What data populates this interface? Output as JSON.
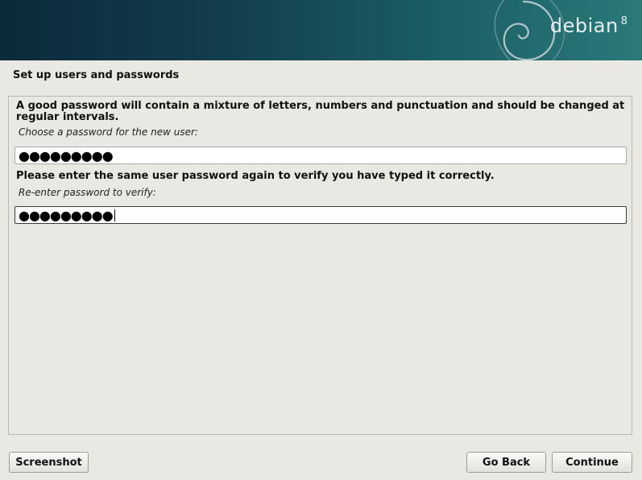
{
  "header": {
    "brand_name": "debian",
    "brand_version": "8",
    "logo_icon": "debian-swirl-icon"
  },
  "page": {
    "title": "Set up users and passwords"
  },
  "form": {
    "help_text_line1": "A good password will contain a mixture of letters, numbers and punctuation and should be changed at",
    "help_text_line2": "regular intervals.",
    "password_label": "Choose a password for the new user:",
    "password_value": "●●●●●●●●●",
    "verify_instruction": "Please enter the same user password again to verify you have typed it correctly.",
    "verify_label": "Re-enter password to verify:",
    "verify_value": "●●●●●●●●●"
  },
  "buttons": {
    "screenshot": "Screenshot",
    "go_back": "Go Back",
    "continue": "Continue"
  },
  "colors": {
    "banner_dark": "#0c2a38",
    "banner_light": "#2a7a78",
    "background": "#eae8e3"
  }
}
